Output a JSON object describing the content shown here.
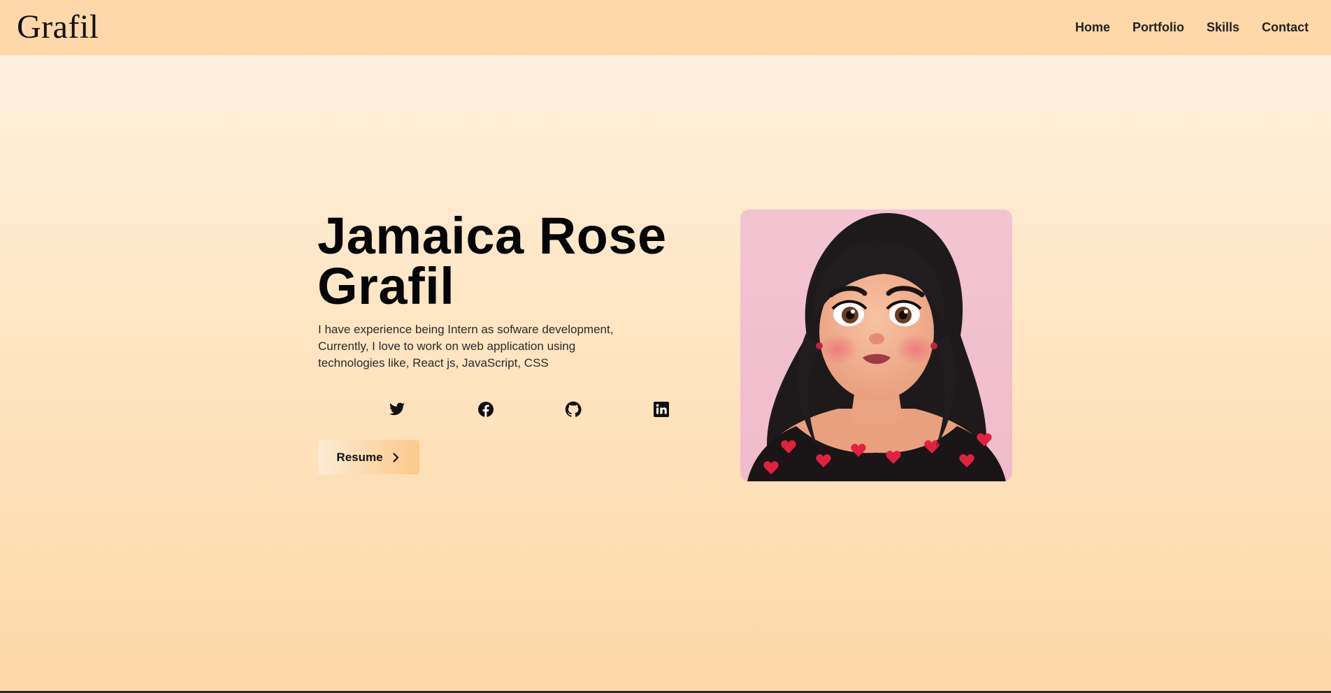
{
  "header": {
    "brand": "Grafil",
    "nav": [
      {
        "label": "Home"
      },
      {
        "label": "Portfolio"
      },
      {
        "label": "Skills"
      },
      {
        "label": "Contact"
      }
    ]
  },
  "hero": {
    "title_lines": [
      "Jamaica Rose",
      "Grafil"
    ],
    "description_lines": [
      "I have experience being Intern as sofware development,",
      "Currently, I love to work on web application using",
      "technologies like, React js, JavaScript, CSS"
    ],
    "socials": [
      {
        "icon": "twitter-icon"
      },
      {
        "icon": "facebook-icon"
      },
      {
        "icon": "github-icon"
      },
      {
        "icon": "linkedin-icon"
      }
    ],
    "resume_label": "Resume",
    "resume_icon": "chevron-right-icon"
  },
  "colors": {
    "header_bg": "#fed8a9",
    "page_gradient_top": "#fff2e3",
    "page_gradient_bottom": "#fdd8a9",
    "button_gradient_start": "#fdebd3",
    "button_gradient_end": "#fbc98b",
    "avatar_bg": "#f2c4d2"
  }
}
